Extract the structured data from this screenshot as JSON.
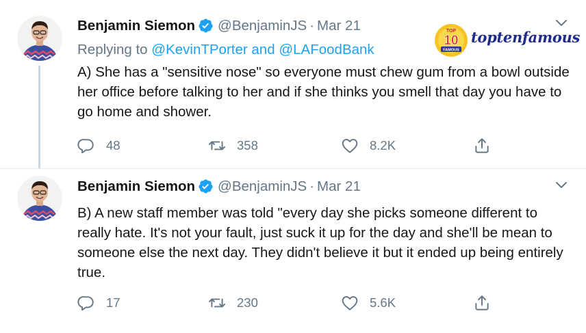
{
  "tweets": [
    {
      "author_name": "Benjamin Siemon",
      "handle": "@BenjaminJS",
      "date": "Mar 21",
      "replying_label": "Replying to",
      "replying_mention1": "@KevinTPorter",
      "replying_and": "and",
      "replying_mention2": "@LAFoodBank",
      "text": "A) She has a \"sensitive nose\" so everyone must chew gum from a bowl outside her office before talking to her and if she thinks you smell that day you have to go home and shower.",
      "replies": "48",
      "retweets": "358",
      "likes": "8.2K"
    },
    {
      "author_name": "Benjamin Siemon",
      "handle": "@BenjaminJS",
      "date": "Mar 21",
      "text": "B) A new staff member was told \"every day she picks someone different to really hate. It's not your fault, just suck it up for the day and she'll be mean to someone else the next day. They didn't believe it but it ended up being entirely true.",
      "replies": "17",
      "retweets": "230",
      "likes": "5.6K"
    }
  ],
  "watermark": {
    "badge_top": "TOP",
    "badge_number": "10",
    "badge_bottom": "FAMOUS",
    "brand": "toptenfamous"
  },
  "icons": {
    "verified": "verified-badge-icon",
    "more": "chevron-down-icon",
    "reply": "reply-icon",
    "retweet": "retweet-icon",
    "like": "heart-icon",
    "share": "share-icon"
  },
  "colors": {
    "accent": "#1da1f2",
    "secondary_text": "#657786",
    "primary_text": "#14171a",
    "divider": "#e6ecf0"
  }
}
